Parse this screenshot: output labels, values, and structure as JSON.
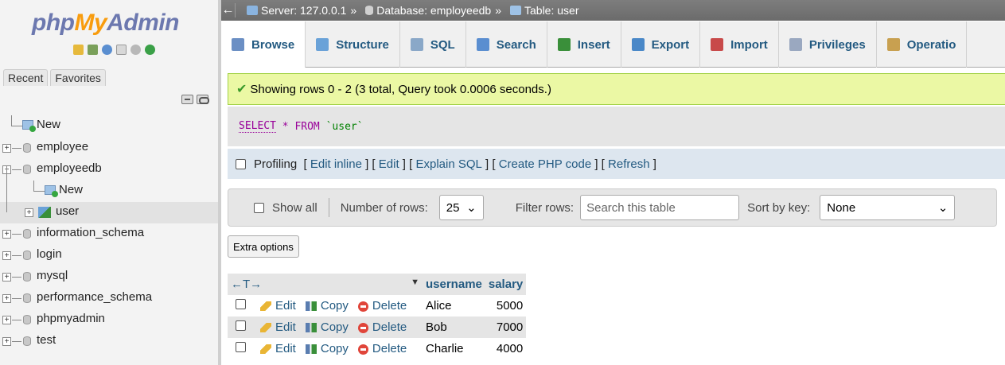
{
  "logo": {
    "php": "php",
    "my": "My",
    "admin": "Admin"
  },
  "nav": {
    "tabs": [
      "Recent",
      "Favorites"
    ],
    "tree": [
      {
        "label": "New",
        "type": "new"
      },
      {
        "label": "employee",
        "type": "db"
      },
      {
        "label": "employeedb",
        "type": "db",
        "expanded": true
      },
      {
        "label": "New",
        "type": "new",
        "child": true
      },
      {
        "label": "user",
        "type": "table",
        "child": true,
        "selected": true
      },
      {
        "label": "information_schema",
        "type": "db"
      },
      {
        "label": "login",
        "type": "db"
      },
      {
        "label": "mysql",
        "type": "db"
      },
      {
        "label": "performance_schema",
        "type": "db"
      },
      {
        "label": "phpmyadmin",
        "type": "db"
      },
      {
        "label": "test",
        "type": "db"
      }
    ]
  },
  "breadcrumb": {
    "back": "←",
    "server": "Server: 127.0.0.1",
    "database": "Database: employeedb",
    "table": "Table: user",
    "separator": "»"
  },
  "tabs": [
    {
      "label": "Browse",
      "icon": "browse-icon",
      "color": "#6b8fc4"
    },
    {
      "label": "Structure",
      "icon": "structure-icon",
      "color": "#6aa2d8"
    },
    {
      "label": "SQL",
      "icon": "sql-icon",
      "color": "#8aa8c8"
    },
    {
      "label": "Search",
      "icon": "search-icon",
      "color": "#5a8ed0"
    },
    {
      "label": "Insert",
      "icon": "insert-icon",
      "color": "#3a8f3a"
    },
    {
      "label": "Export",
      "icon": "export-icon",
      "color": "#4a88c8"
    },
    {
      "label": "Import",
      "icon": "import-icon",
      "color": "#c84a4a"
    },
    {
      "label": "Privileges",
      "icon": "privileges-icon",
      "color": "#9aa8c0"
    },
    {
      "label": "Operatio",
      "icon": "operations-icon",
      "color": "#c8a050"
    }
  ],
  "message": {
    "text": "Showing rows 0 - 2 (3 total, Query took 0.0006 seconds.)"
  },
  "sql": {
    "select": "SELECT",
    "star": "*",
    "from": "FROM",
    "table": "`user`"
  },
  "profiling": {
    "label": "Profiling",
    "links": [
      "Edit inline",
      "Edit",
      "Explain SQL",
      "Create PHP code",
      "Refresh"
    ]
  },
  "filter": {
    "show_all": "Show all",
    "rows_label": "Number of rows:",
    "rows_value": "25",
    "filter_label": "Filter rows:",
    "filter_placeholder": "Search this table",
    "sort_label": "Sort by key:",
    "sort_value": "None"
  },
  "extra_options": "Extra options",
  "results": {
    "arrows": "←T→",
    "sort_marker": "▼",
    "columns": [
      "username",
      "salary"
    ],
    "actions": {
      "edit": "Edit",
      "copy": "Copy",
      "delete": "Delete"
    },
    "rows": [
      {
        "username": "Alice",
        "salary": "5000"
      },
      {
        "username": "Bob",
        "salary": "7000"
      },
      {
        "username": "Charlie",
        "salary": "4000"
      }
    ]
  },
  "colors": {
    "link": "#235a81",
    "success_bg": "#ebf8a4",
    "success_border": "#a2d246",
    "topbar": "#737373"
  }
}
